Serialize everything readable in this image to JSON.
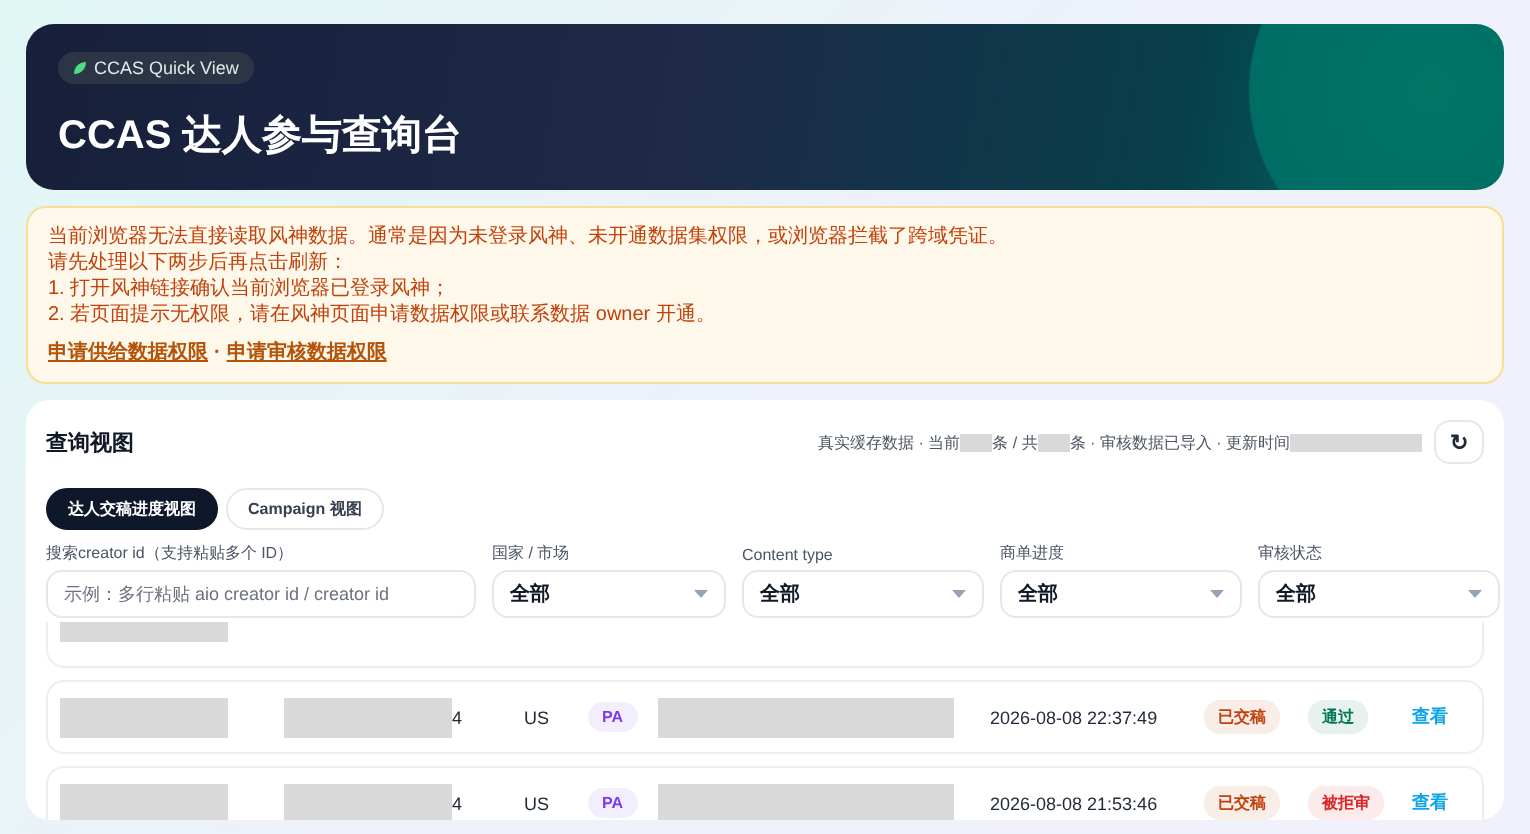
{
  "hero": {
    "badge": "CCAS Quick View",
    "title": "CCAS 达人参与查询台"
  },
  "notice": {
    "lines": [
      "当前浏览器无法直接读取风神数据。通常是因为未登录风神、未开通数据集权限，或浏览器拦截了跨域凭证。",
      "请先处理以下两步后再点击刷新：",
      "1. 打开风神链接确认当前浏览器已登录风神；",
      "2. 若页面提示无权限，请在风神页面申请数据权限或联系数据 owner 开通。"
    ],
    "links": [
      "申请供给数据权限",
      "申请审核数据权限"
    ],
    "separator": "·"
  },
  "panel": {
    "title": "查询视图",
    "meta": [
      "真实缓存数据 · 当前",
      "条 / 共",
      "条 · 审核数据已导入 · 更新时间"
    ],
    "refresh": "↻",
    "tabs": [
      {
        "label": "达人交稿进度视图",
        "selected": true
      },
      {
        "label": "Campaign 视图",
        "selected": false
      }
    ],
    "filters": [
      {
        "kind": "search",
        "label": "搜索creator id（支持粘贴多个 ID）",
        "placeholder": "示例：多行粘贴 aio creator id / creator id"
      },
      {
        "kind": "select",
        "label": "国家 / 市场",
        "value": "全部"
      },
      {
        "kind": "select",
        "label": "Content type",
        "value": "全部"
      },
      {
        "kind": "select",
        "label": "商单进度",
        "value": "全部"
      },
      {
        "kind": "select",
        "label": "审核状态",
        "value": "全部"
      }
    ],
    "rows": [
      {
        "kind": "partial"
      },
      {
        "kind": "full",
        "id_tail": "4",
        "country": "US",
        "type": "PA",
        "date": "2026-08-08 22:37:49",
        "submission": {
          "label": "已交稿",
          "color": "#c2410c"
        },
        "review": {
          "label": "通过",
          "color": "#047857"
        },
        "action": "查看"
      },
      {
        "kind": "full",
        "id_tail": "4",
        "country": "US",
        "type": "PA",
        "date": "2026-08-08 21:53:46",
        "submission": {
          "label": "已交稿",
          "color": "#c2410c"
        },
        "review": {
          "label": "被拒审",
          "color": "#dc2626"
        },
        "action": "查看"
      }
    ]
  }
}
